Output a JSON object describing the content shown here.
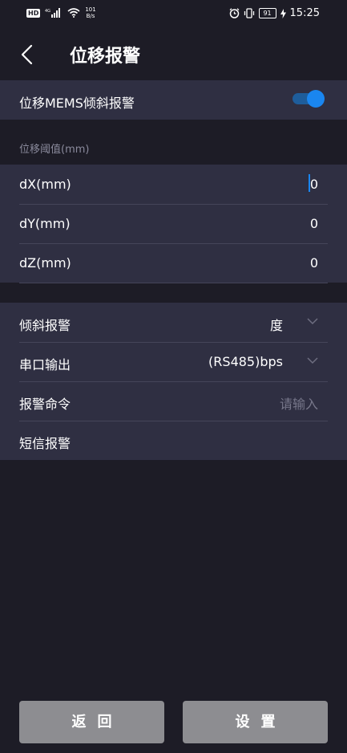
{
  "status": {
    "net_speed_value": "101",
    "net_speed_unit": "B/s",
    "net_type": "4G",
    "battery": "91",
    "time": "15:25"
  },
  "header": {
    "title": "位移报警"
  },
  "mems": {
    "label": "位移MEMS倾斜报警",
    "enabled": true
  },
  "threshold": {
    "caption": "位移阈值(mm)",
    "rows": [
      {
        "label": "dX(mm)",
        "value": "0"
      },
      {
        "label": "dY(mm)",
        "value": "0"
      },
      {
        "label": "dZ(mm)",
        "value": "0"
      }
    ]
  },
  "settings": {
    "tilt": {
      "label": "倾斜报警",
      "value": "度"
    },
    "serial": {
      "label": "串口输出",
      "value": "(RS485)bps"
    },
    "command": {
      "label": "报警命令",
      "placeholder": "请输入"
    },
    "sms": {
      "label": "短信报警"
    }
  },
  "buttons": {
    "back": "返回",
    "set": "设置"
  },
  "colors": {
    "accent": "#1a86f0",
    "background": "#1d1c26",
    "panel": "#2f2f42",
    "button": "#8d8d91"
  }
}
